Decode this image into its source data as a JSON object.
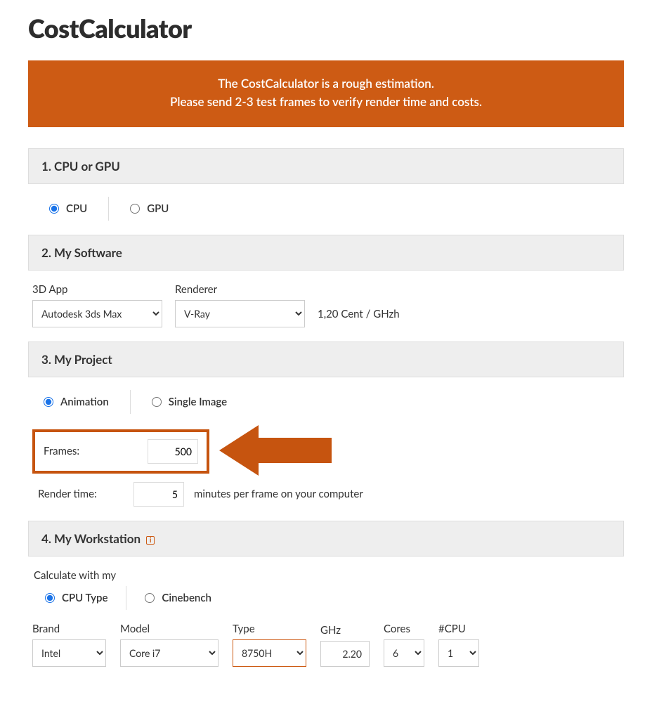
{
  "title": "CostCalculator",
  "banner": {
    "line1": "The CostCalculator is a rough estimation.",
    "line2": "Please send 2-3 test frames to verify render time and costs."
  },
  "section1": {
    "title": "1. CPU or GPU",
    "options": {
      "cpu": "CPU",
      "gpu": "GPU"
    },
    "selected": "cpu"
  },
  "section2": {
    "title": "2. My Software",
    "app_label": "3D App",
    "renderer_label": "Renderer",
    "app_value": "Autodesk 3ds Max",
    "renderer_value": "V-Ray",
    "price_text": "1,20 Cent / GHzh"
  },
  "section3": {
    "title": "3. My Project",
    "options": {
      "animation": "Animation",
      "single": "Single Image"
    },
    "selected": "animation",
    "frames_label": "Frames:",
    "frames_value": "500",
    "rendertime_label": "Render time:",
    "rendertime_value": "5",
    "rendertime_suffix": "minutes per frame on your computer"
  },
  "section4": {
    "title": "4. My Workstation",
    "calc_label": "Calculate with my",
    "options": {
      "cputype": "CPU Type",
      "cinebench": "Cinebench"
    },
    "selected": "cputype",
    "cols": {
      "brand": "Brand",
      "model": "Model",
      "type": "Type",
      "ghz": "GHz",
      "cores": "Cores",
      "numcpu": "#CPU"
    },
    "values": {
      "brand": "Intel",
      "model": "Core i7",
      "type": "8750H",
      "ghz": "2.20",
      "cores": "6",
      "numcpu": "1"
    }
  }
}
